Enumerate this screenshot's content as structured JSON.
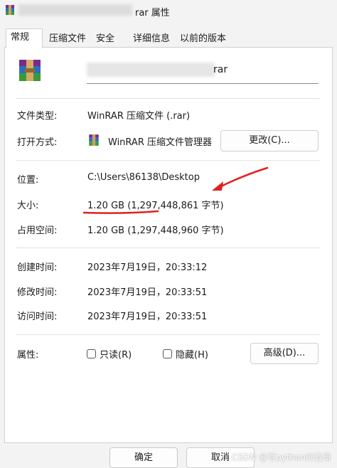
{
  "window": {
    "title_suffix": "rar 属性"
  },
  "tabs": [
    {
      "label": "常规",
      "active": true
    },
    {
      "label": "压缩文件",
      "active": false
    },
    {
      "label": "安全",
      "active": false
    },
    {
      "label": "详细信息",
      "active": false
    },
    {
      "label": "以前的版本",
      "active": false
    }
  ],
  "file": {
    "name_suffix": "rar",
    "icon": "winrar-archive-icon"
  },
  "details": {
    "type_label": "文件类型:",
    "type_value": "WinRAR 压缩文件 (.rar)",
    "open_with_label": "打开方式:",
    "open_with_value": "WinRAR 压缩文件管理器",
    "change_button": "更改(C)...",
    "location_label": "位置:",
    "location_value": "C:\\Users\\86138\\Desktop",
    "size_label": "大小:",
    "size_value": "1.20 GB (1,297,448,861 字节)",
    "size_on_disk_label": "占用空间:",
    "size_on_disk_value": "1.20 GB (1,297,448,960 字节)",
    "created_label": "创建时间:",
    "created_value": "2023年7月19日，20:33:12",
    "modified_label": "修改时间:",
    "modified_value": "2023年7月19日，20:33:51",
    "accessed_label": "访问时间:",
    "accessed_value": "2023年7月19日，20:33:51",
    "attributes_label": "属性:",
    "readonly_label": "只读(R)",
    "hidden_label": "隐藏(H)",
    "advanced_button": "高级(D)..."
  },
  "footer": {
    "ok": "确定",
    "cancel": "取消"
  },
  "watermark": "CSDN @写python的鑫哥",
  "colors": {
    "annotation_red": "#e02020",
    "accent": "#0067c0"
  }
}
